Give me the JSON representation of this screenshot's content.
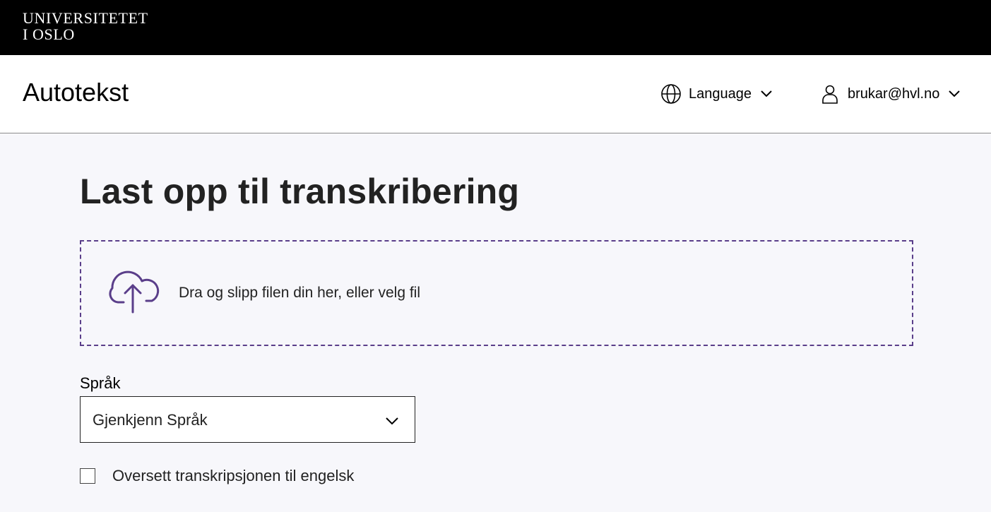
{
  "banner": {
    "logo_line1": "UNIVERSITETET",
    "logo_line2": "I OSLO"
  },
  "header": {
    "app_title": "Autotekst",
    "language_menu": {
      "label": "Language",
      "icon": "globe-icon"
    },
    "user_menu": {
      "label": "brukar@hvl.no",
      "icon": "user-icon"
    }
  },
  "main": {
    "title": "Last opp til transkribering",
    "dropzone": {
      "text": "Dra og slipp filen din her, eller velg fil",
      "icon": "cloud-upload-icon"
    },
    "language_field": {
      "label": "Språk",
      "selected_value": "Gjenkjenn Språk"
    },
    "translate_option": {
      "label": "Oversett transkripsjonen til engelsk",
      "checked": false
    }
  },
  "colors": {
    "banner_bg": "#000000",
    "page_bg": "#f7f7fb",
    "accent": "#5a3e8a"
  }
}
